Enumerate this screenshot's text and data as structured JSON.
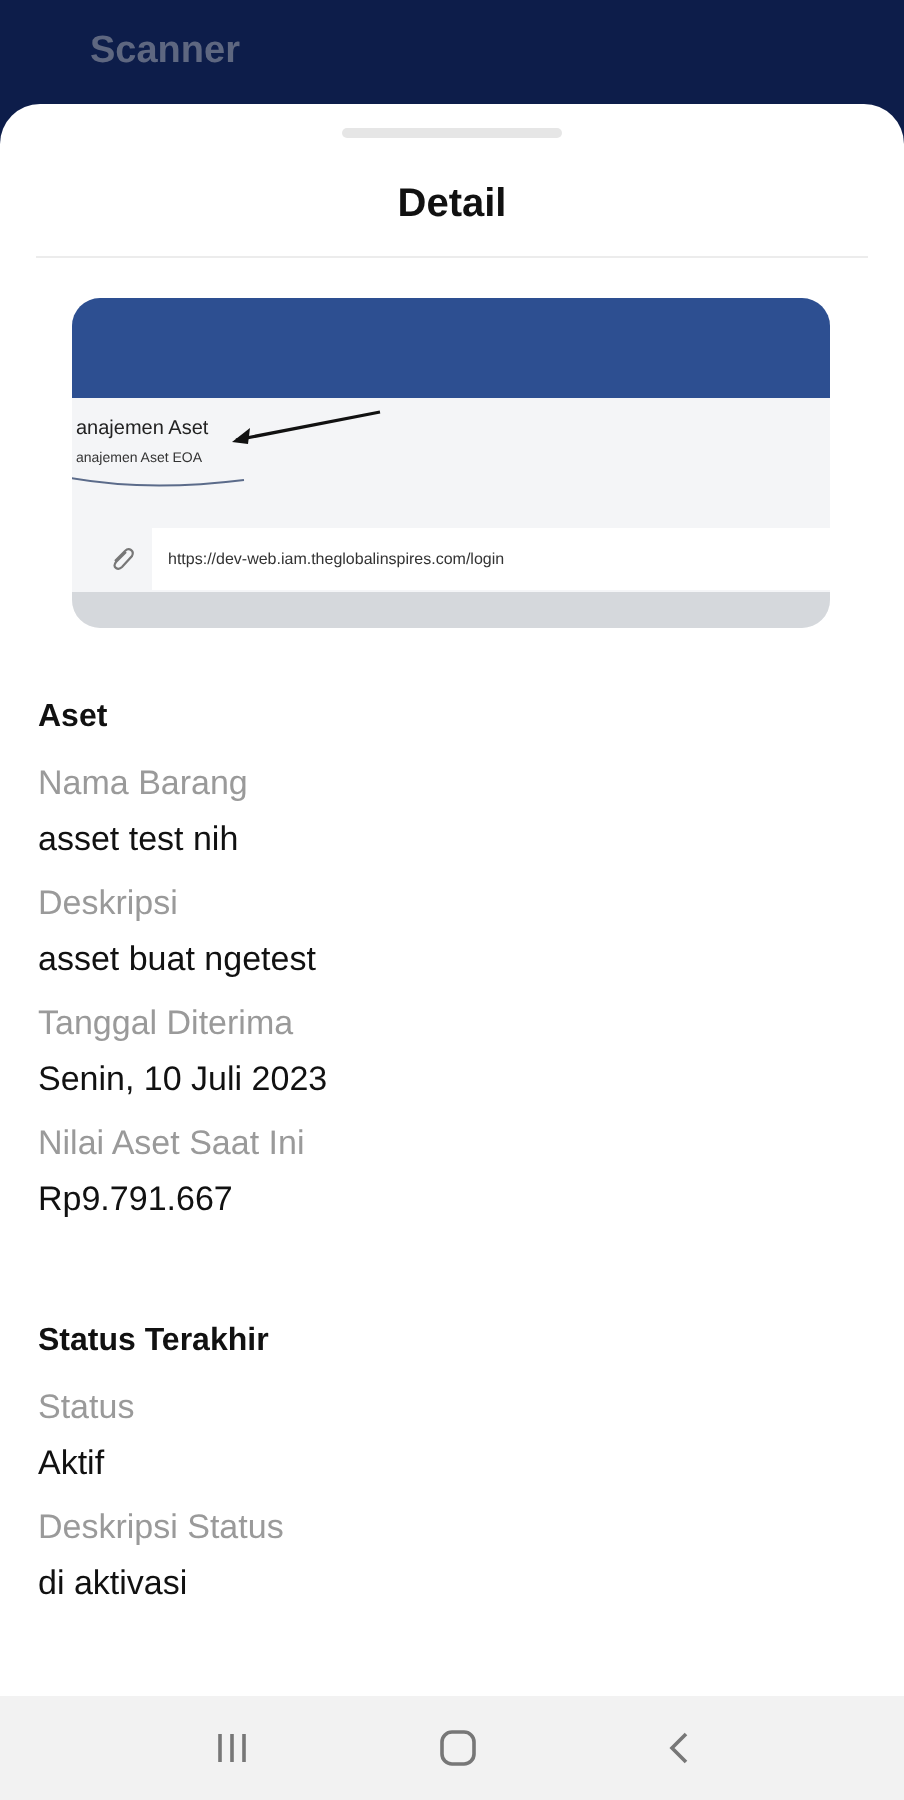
{
  "app_bar": {
    "title": "Scanner"
  },
  "sheet": {
    "title": "Detail",
    "attachment": {
      "heading": "anajemen Aset",
      "subheading": "anajemen Aset EOA",
      "url": "https://dev-web.iam.theglobalinspires.com/login"
    },
    "sections": [
      {
        "title": "Aset",
        "fields": [
          {
            "label": "Nama Barang",
            "value": "asset test nih"
          },
          {
            "label": "Deskripsi",
            "value": "asset buat ngetest"
          },
          {
            "label": "Tanggal Diterima",
            "value": "Senin, 10 Juli 2023"
          },
          {
            "label": "Nilai Aset Saat Ini",
            "value": "Rp9.791.667"
          }
        ]
      },
      {
        "title": "Status Terakhir",
        "fields": [
          {
            "label": "Status",
            "value": "Aktif"
          },
          {
            "label": "Deskripsi Status",
            "value": "di aktivasi"
          }
        ]
      }
    ]
  }
}
